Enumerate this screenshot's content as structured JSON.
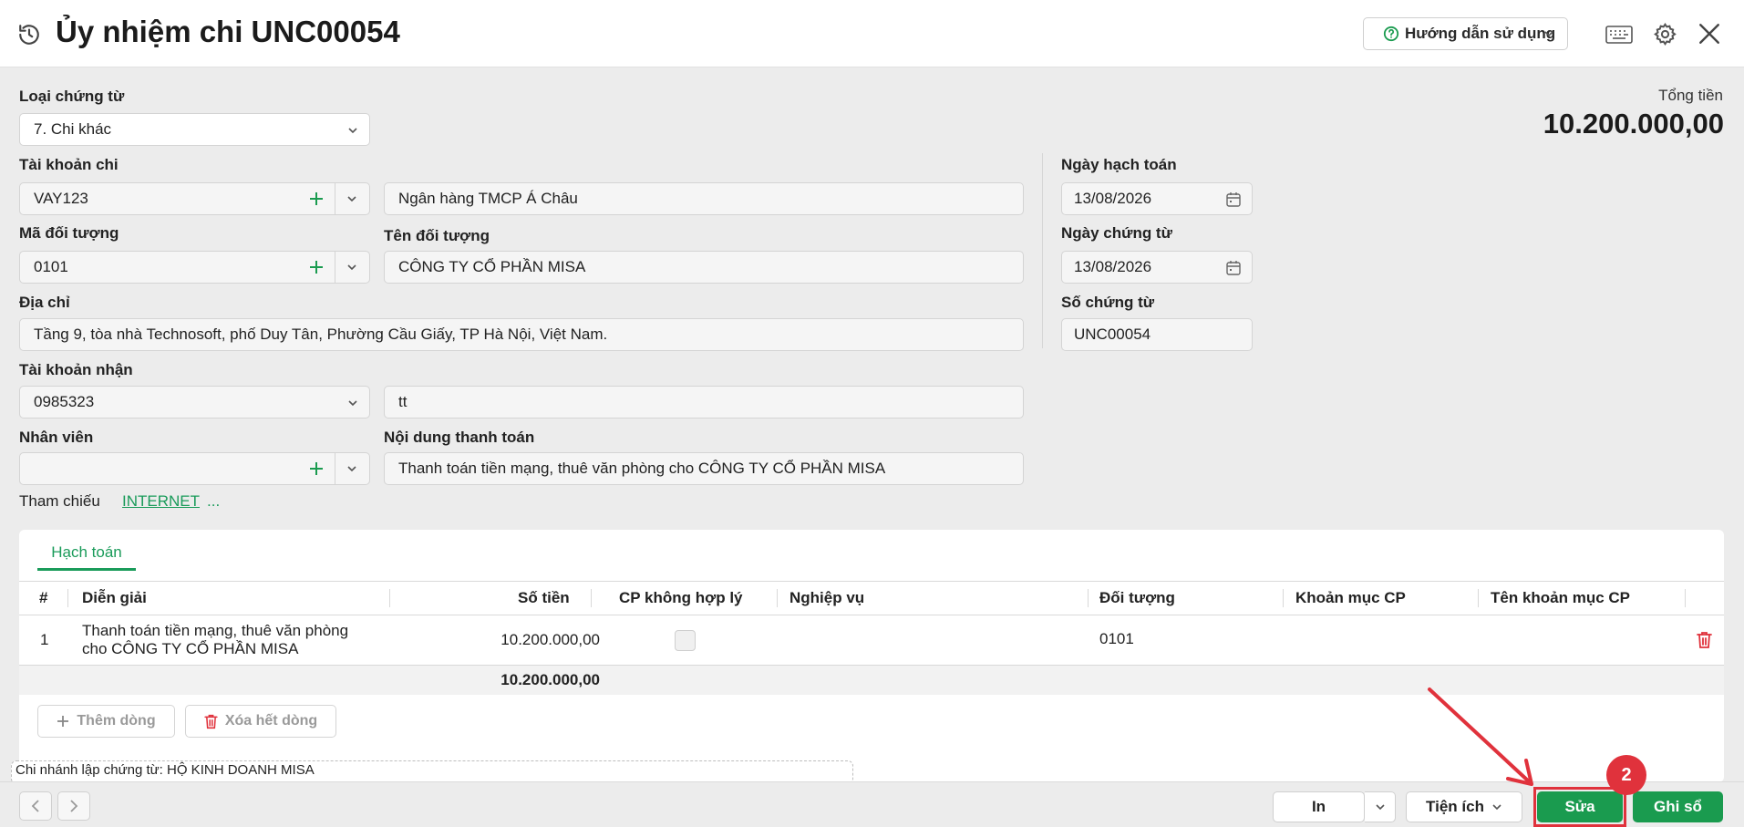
{
  "header": {
    "title": "Ủy nhiệm chi UNC00054",
    "help_label": "Hướng dẫn sử dụng"
  },
  "form": {
    "doc_type": {
      "label": "Loại chứng từ",
      "value": "7. Chi khác"
    },
    "pay_account": {
      "label": "Tài khoản chi",
      "value": "VAY123",
      "bank_name": "Ngân hàng TMCP Á Châu"
    },
    "object_code": {
      "label": "Mã đối tượng",
      "value": "0101"
    },
    "object_name": {
      "label": "Tên đối tượng",
      "value": "CÔNG TY CỔ PHẦN MISA"
    },
    "address": {
      "label": "Địa chỉ",
      "value": "Tầng 9, tòa nhà Technosoft, phố Duy Tân, Phường Cầu Giấy, TP Hà Nội, Việt Nam."
    },
    "receive_account": {
      "label": "Tài khoản nhận",
      "value": "0985323",
      "extra": "tt"
    },
    "employee": {
      "label": "Nhân viên",
      "value": ""
    },
    "payment_content": {
      "label": "Nội dung thanh toán",
      "value": "Thanh toán tiền mạng, thuê văn phòng cho CÔNG TY CỔ PHẦN MISA"
    },
    "reference": {
      "label": "Tham chiếu",
      "link": "INTERNET",
      "more": "..."
    },
    "posting_date": {
      "label": "Ngày hạch toán",
      "value": "13/08/2026"
    },
    "doc_date": {
      "label": "Ngày chứng từ",
      "value": "13/08/2026"
    },
    "doc_number": {
      "label": "Số chứng từ",
      "value": "UNC00054"
    },
    "total": {
      "label": "Tổng tiền",
      "value": "10.200.000,00"
    }
  },
  "grid": {
    "tab": "Hạch toán",
    "columns": [
      "#",
      "Diễn giải",
      "Số tiền",
      "CP không hợp lý",
      "Nghiệp vụ",
      "Đối tượng",
      "Khoản mục CP",
      "Tên khoản mục CP"
    ],
    "rows": [
      {
        "no": "1",
        "desc_line1": "Thanh toán tiền mạng, thuê văn phòng",
        "desc_line2": "cho CÔNG TY CỔ PHẦN MISA",
        "amount": "10.200.000,00",
        "object": "0101"
      }
    ],
    "sum": "10.200.000,00",
    "add_row": "Thêm dòng",
    "delete_all": "Xóa hết dòng"
  },
  "branch": "Chi nhánh lập chứng từ: HỘ KINH DOANH MISA",
  "footer": {
    "print": "In",
    "utilities": "Tiện ích",
    "edit": "Sửa",
    "post": "Ghi sổ"
  },
  "annotation": {
    "step": "2"
  },
  "colors": {
    "accent": "#1a9b4f",
    "highlight": "#e0323c"
  }
}
